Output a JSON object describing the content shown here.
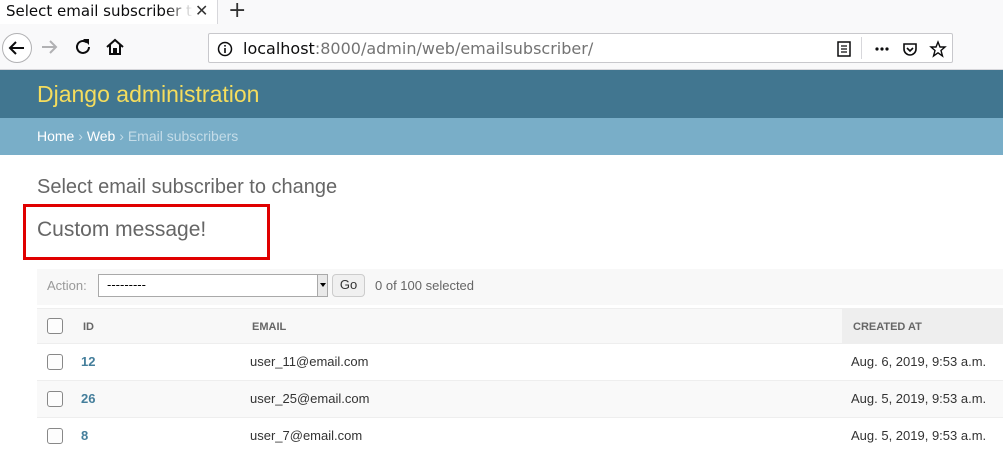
{
  "browser": {
    "tab_title": "Select email subscriber to change",
    "url_host": "localhost",
    "url_path": ":8000/admin/web/emailsubscriber/"
  },
  "header": {
    "branding": "Django administration"
  },
  "breadcrumbs": {
    "home": "Home",
    "sep1": " › ",
    "app": "Web",
    "sep2": " › ",
    "current": "Email subscribers"
  },
  "content": {
    "title": "Select email subscriber to change",
    "custom_message": "Custom message!"
  },
  "actions": {
    "label": "Action:",
    "selected_option": "---------",
    "go_label": "Go",
    "selected_count": "0 of 100 selected"
  },
  "table": {
    "headers": {
      "id": "ID",
      "email": "Email",
      "created_at": "Created at"
    },
    "rows": [
      {
        "id": "12",
        "email": "user_11@email.com",
        "created_at": "Aug. 6, 2019, 9:53 a.m."
      },
      {
        "id": "26",
        "email": "user_25@email.com",
        "created_at": "Aug. 5, 2019, 9:53 a.m."
      },
      {
        "id": "8",
        "email": "user_7@email.com",
        "created_at": "Aug. 5, 2019, 9:53 a.m."
      }
    ]
  },
  "colors": {
    "header_bg": "#417690",
    "branding": "#f5dd5d",
    "breadcrumbs_bg": "#79aec8",
    "highlight_border": "#e00000",
    "link": "#447e9b"
  }
}
